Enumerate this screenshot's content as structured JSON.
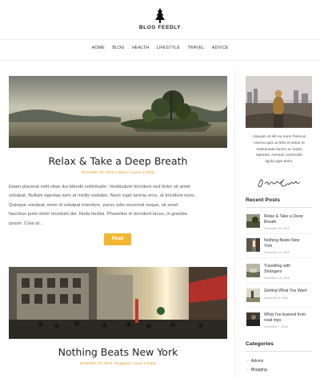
{
  "site": {
    "name": "BLOG FEEDLY"
  },
  "nav": [
    "HOME",
    "BLOG",
    "HEALTH",
    "LIFESTYLE",
    "TRAVEL",
    "ADVICE"
  ],
  "posts": [
    {
      "title": "Relax & Take a Deep Breath",
      "date": "December 25, 2018",
      "category": "Advice",
      "reply": "Leave a Reply",
      "excerpt_lines": [
        "Etiam placerat velit vitae dui blandit sollicitudin. Vestibulum tincidunt sed dolor sit amet",
        "volutpat. Nullam egestas sem at mollis sodales. Nunc eget lacinia eros, ut tincidunt nunc.",
        "Quisque volutpat, enim id volutpat interdum, purus odio euismod neque, sit amet",
        "faucibus justo dolor tincidunt dui. Nulla facilisi. Phasellus in tincidunt lacus, in gravida",
        "ipsum. Cras id…"
      ],
      "read_label": "Read"
    },
    {
      "title": "Nothing Beats New York",
      "date": "December 23, 2018",
      "category": "Blogging",
      "reply": "Leave a Reply"
    }
  ],
  "sidebar": {
    "about_lines": [
      "Aliquam et elit eu nunc rhoncus",
      "viverra quis at felis et netus et",
      "malesuada fames ac turpis",
      "egestas. Aenean commodo",
      "ligula eget dolor."
    ],
    "signature": "Jennifer Carter",
    "recent_heading": "Recent Posts",
    "recent": [
      {
        "title_lines": [
          "Relax & Take a Deep",
          "Breath"
        ],
        "date": "December 25, 2018"
      },
      {
        "title_lines": [
          "Nothing Beats New",
          "York"
        ],
        "date": "December 23, 2018"
      },
      {
        "title_lines": [
          "Travelling with",
          "Strangers"
        ],
        "date": "December 18, 2018"
      },
      {
        "title_lines": [
          "Getting What You Want"
        ],
        "date": "December 8, 2018"
      },
      {
        "title_lines": [
          "What I've learned from",
          "road trips"
        ],
        "date": "December 7, 2018"
      }
    ],
    "categories_heading": "Categories",
    "categories": [
      "Advice",
      "Blogging"
    ]
  },
  "colors": {
    "accent": "#f2b632",
    "meta": "#e69b1f"
  }
}
